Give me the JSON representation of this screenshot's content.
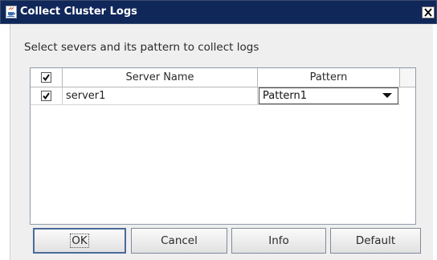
{
  "window": {
    "title": "Collect Cluster Logs",
    "app_icon": "java-cup-icon",
    "close_icon": "close-icon"
  },
  "dialog": {
    "instruction": "Select severs and its pattern to collect logs"
  },
  "table": {
    "header_checked": true,
    "columns": [
      "Server Name",
      "Pattern"
    ],
    "rows": [
      {
        "checked": true,
        "server": "server1",
        "pattern": "Pattern1"
      }
    ]
  },
  "buttons": {
    "ok": "OK",
    "cancel": "Cancel",
    "info": "Info",
    "default": "Default"
  },
  "colors": {
    "titlebar": "#10275a",
    "client_bg": "#efefef",
    "focus_border": "#4a6a9a"
  }
}
